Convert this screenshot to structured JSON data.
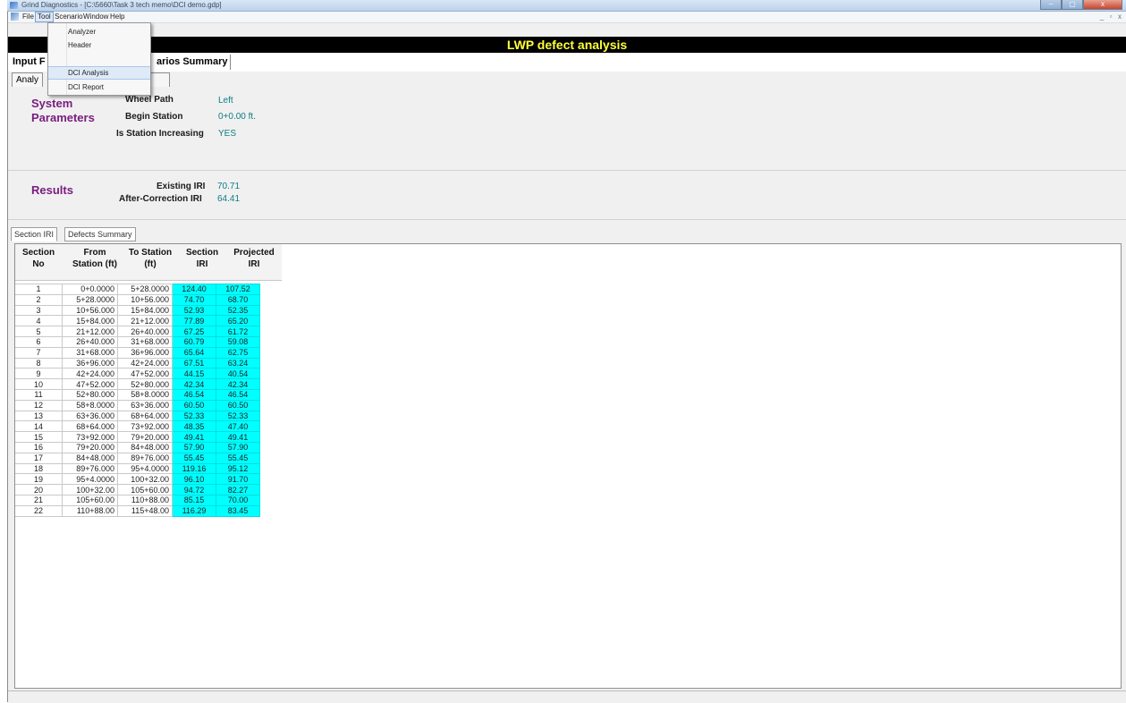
{
  "window": {
    "title": "Grind Diagnostics - [C:\\5660\\Task 3 tech memo\\DCI demo.gdp]",
    "minimize": "–",
    "restore": "▢",
    "close": "x"
  },
  "menubar": {
    "items": [
      "File",
      "Tool",
      "Scenario",
      "Window",
      "Help"
    ],
    "mdi_controls": [
      "_",
      "▫",
      "x"
    ]
  },
  "tool_menu": {
    "items": [
      "Analyzer",
      "Header",
      "DCI Analysis",
      "DCI Report"
    ],
    "highlighted": "DCI Analysis"
  },
  "header": {
    "title": "LWP defect analysis"
  },
  "top_tabs": {
    "input": "Input F",
    "scenarios_summary": "arios Summary"
  },
  "sub_tabs": {
    "analy": "Analy"
  },
  "system_parameters": {
    "heading_line1": "System",
    "heading_line2": "Parameters",
    "fields": [
      {
        "label": "Wheel Path",
        "value": "Left"
      },
      {
        "label": "Begin Station",
        "value": "0+0.00 ft."
      },
      {
        "label": "Is Station Increasing",
        "value": "YES"
      }
    ]
  },
  "results": {
    "heading": "Results",
    "fields": [
      {
        "label": "Existing IRI",
        "value": "70.71"
      },
      {
        "label": "After-Correction IRI",
        "value": "64.41"
      }
    ]
  },
  "section_tabs": [
    "Section IRI",
    "Defects Summary"
  ],
  "grid": {
    "headers": {
      "section_no": [
        "Section",
        "No"
      ],
      "from": [
        "From",
        "Station (ft)"
      ],
      "to": [
        "To Station",
        "(ft)"
      ],
      "section_iri": [
        "Section",
        "IRI"
      ],
      "projected_iri": [
        "Projected",
        "IRI"
      ]
    },
    "rows": [
      [
        "1",
        "0+0.0000",
        "5+28.0000",
        "124.40",
        "107.52"
      ],
      [
        "2",
        "5+28.0000",
        "10+56.000",
        "74.70",
        "68.70"
      ],
      [
        "3",
        "10+56.000",
        "15+84.000",
        "52.93",
        "52.35"
      ],
      [
        "4",
        "15+84.000",
        "21+12.000",
        "77.89",
        "65.20"
      ],
      [
        "5",
        "21+12.000",
        "26+40.000",
        "67.25",
        "61.72"
      ],
      [
        "6",
        "26+40.000",
        "31+68.000",
        "60.79",
        "59.08"
      ],
      [
        "7",
        "31+68.000",
        "36+96.000",
        "65.64",
        "62.75"
      ],
      [
        "8",
        "36+96.000",
        "42+24.000",
        "67.51",
        "63.24"
      ],
      [
        "9",
        "42+24.000",
        "47+52.000",
        "44.15",
        "40.54"
      ],
      [
        "10",
        "47+52.000",
        "52+80.000",
        "42.34",
        "42.34"
      ],
      [
        "11",
        "52+80.000",
        "58+8.0000",
        "46.54",
        "46.54"
      ],
      [
        "12",
        "58+8.0000",
        "63+36.000",
        "60.50",
        "60.50"
      ],
      [
        "13",
        "63+36.000",
        "68+64.000",
        "52.33",
        "52.33"
      ],
      [
        "14",
        "68+64.000",
        "73+92.000",
        "48.35",
        "47.40"
      ],
      [
        "15",
        "73+92.000",
        "79+20.000",
        "49.41",
        "49.41"
      ],
      [
        "16",
        "79+20.000",
        "84+48.000",
        "57.90",
        "57.90"
      ],
      [
        "17",
        "84+48.000",
        "89+76.000",
        "55.45",
        "55.45"
      ],
      [
        "18",
        "89+76.000",
        "95+4.0000",
        "119.16",
        "95.12"
      ],
      [
        "19",
        "95+4.0000",
        "100+32.00",
        "96.10",
        "91.70"
      ],
      [
        "20",
        "100+32.00",
        "105+60.00",
        "94.72",
        "82.27"
      ],
      [
        "21",
        "105+60.00",
        "110+88.00",
        "85.15",
        "70.00"
      ],
      [
        "22",
        "110+88.00",
        "115+48.00",
        "116.29",
        "83.45"
      ]
    ]
  },
  "colors": {
    "header_bg": "#000000",
    "header_text": "#ffff3c",
    "section_heading": "#7a1d80",
    "value_text": "#0e7c86",
    "iri_cell": "#00ffff"
  }
}
